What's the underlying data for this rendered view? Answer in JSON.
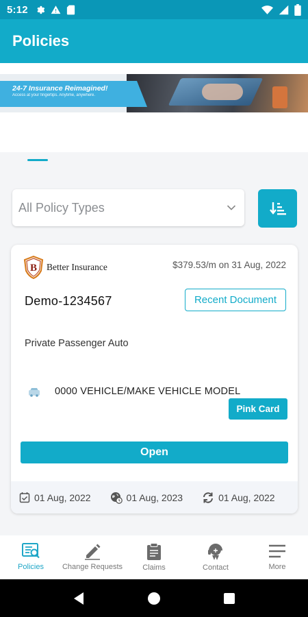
{
  "status_bar": {
    "time": "5:12"
  },
  "app_bar": {
    "title": "Policies"
  },
  "banner": {
    "headline": "24-7 Insurance Reimagined!",
    "subline": "Access at your fingertips. Anytime, anywhere."
  },
  "filter": {
    "selected": "All Policy Types"
  },
  "policy_card": {
    "brand": "Better Insurance",
    "brand_letter": "B",
    "premium": "$379.53/m on 31 Aug, 2022",
    "policy_number": "Demo-1234567",
    "recent_document_label": "Recent Document",
    "policy_type": "Private Passenger Auto",
    "vehicle": "0000 VEHICLE/MAKE VEHICLE MODEL",
    "pink_card_label": "Pink Card",
    "open_label": "Open",
    "dates": {
      "effective": "01 Aug, 2022",
      "expiration": "01 Aug, 2023",
      "renewal": "01 Aug, 2022"
    }
  },
  "bottom_nav": [
    {
      "label": "Policies",
      "icon": "policies-icon",
      "active": true
    },
    {
      "label": "Change Requests",
      "icon": "pencil-icon",
      "active": false
    },
    {
      "label": "Claims",
      "icon": "clipboard-icon",
      "active": false
    },
    {
      "label": "Contact",
      "icon": "support-agent-icon",
      "active": false
    },
    {
      "label": "More",
      "icon": "menu-icon",
      "active": false
    }
  ],
  "colors": {
    "primary": "#12abc9",
    "status_bar": "#0a97b7"
  }
}
